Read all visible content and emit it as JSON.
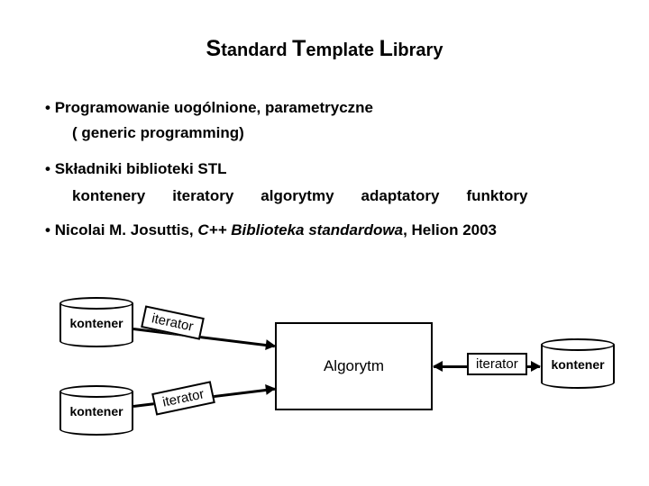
{
  "title_parts": {
    "s": "S",
    "tandard": "tandard ",
    "t": "T",
    "emplate": "emplate ",
    "l": "L",
    "ibrary": "ibrary"
  },
  "bullets": {
    "b1": "Programowanie uogólnione, parametryczne",
    "b1sub": "( generic programming)",
    "b2": "Składniki biblioteki STL",
    "row": {
      "kontenery": "kontenery",
      "iteratory": "iteratory",
      "algorytmy": "algorytmy",
      "adaptatory": "adaptatory",
      "funktory": "funktory"
    },
    "b3_prefix": " Nicolai M. Josuttis, ",
    "b3_italic": "C++ Biblioteka standardowa",
    "b3_suffix": ", Helion 2003"
  },
  "diagram": {
    "kontener": "kontener",
    "iterator": "iterator",
    "algorytm": "Algorytm"
  }
}
